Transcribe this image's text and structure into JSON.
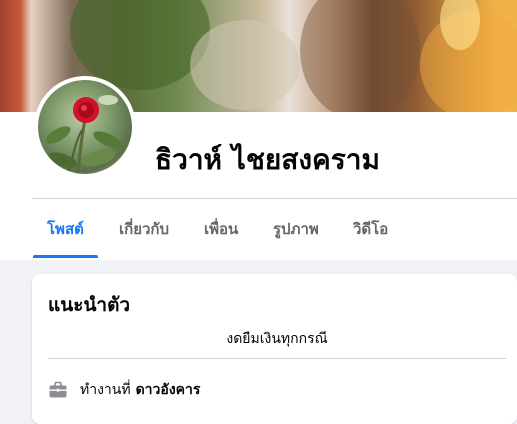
{
  "profile": {
    "name": "ธิวาห์ ไชยสงคราม"
  },
  "tabs": [
    {
      "label": "โพสต์",
      "active": true
    },
    {
      "label": "เกี่ยวกับ",
      "active": false
    },
    {
      "label": "เพื่อน",
      "active": false
    },
    {
      "label": "รูปภาพ",
      "active": false
    },
    {
      "label": "วิดีโอ",
      "active": false
    }
  ],
  "intro": {
    "title": "แนะนำตัว",
    "bio": "งดยืมเงินทุกกรณี",
    "work": {
      "prefix": "ทำงานที่",
      "place": "ดาวอังคาร",
      "icon": "briefcase-icon"
    }
  },
  "colors": {
    "accent": "#1877f2",
    "background": "#f0f2f5",
    "card": "#ffffff",
    "muted_text": "#65676b"
  }
}
